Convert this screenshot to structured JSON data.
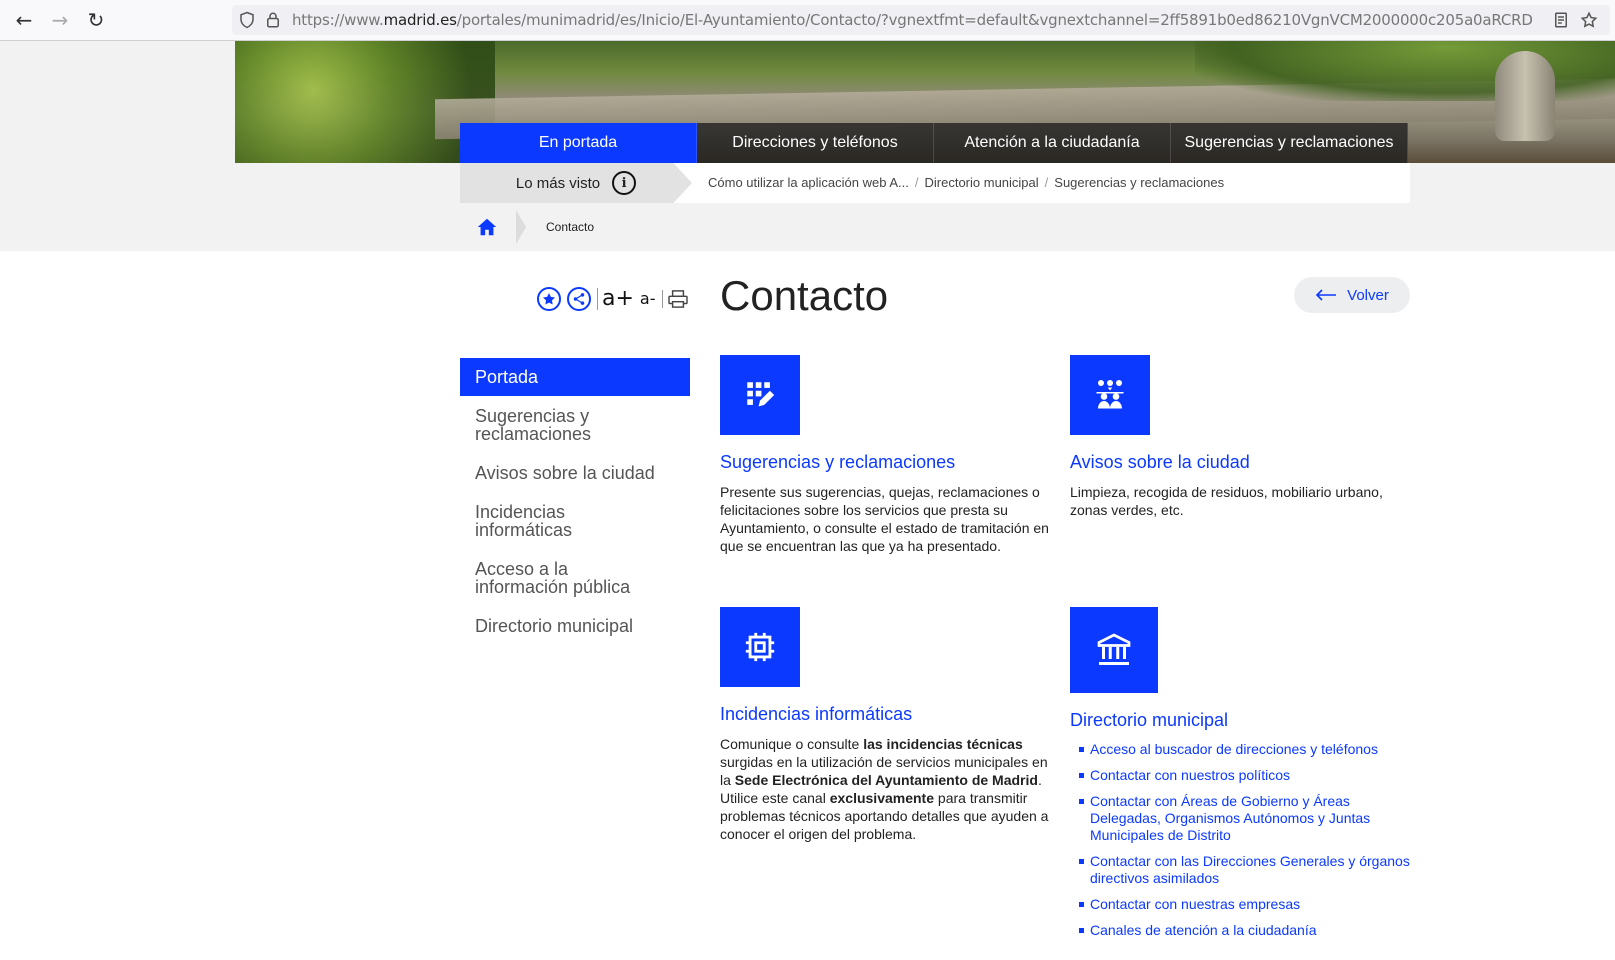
{
  "browser": {
    "url_prefix": "https://www.",
    "url_domain": "madrid.es",
    "url_path": "/portales/munimadrid/es/Inicio/El-Ayuntamiento/Contacto/?vgnextfmt=default&vgnextchannel=2ff5891b0ed86210VgnVCM2000000c205a0aRCRD"
  },
  "topmenu": {
    "items": [
      "En portada",
      "Direcciones y teléfonos",
      "Atención a la ciudadanía",
      "Sugerencias y reclamaciones"
    ]
  },
  "second_row": {
    "mas_visto": "Lo más visto",
    "links": [
      "Cómo utilizar la aplicación web A...",
      "Directorio municipal",
      "Sugerencias y reclamaciones"
    ]
  },
  "breadcrumb": {
    "current": "Contacto"
  },
  "tools": {
    "increase": "a+",
    "decrease": "a-"
  },
  "page": {
    "title": "Contacto",
    "back": "Volver"
  },
  "sidenav": {
    "items": [
      "Portada",
      "Sugerencias y reclamaciones",
      "Avisos sobre la ciudad",
      "Incidencias informáticas",
      "Acceso a la información pública",
      "Directorio municipal"
    ]
  },
  "cards": {
    "sugerencias": {
      "title": "Sugerencias y reclamaciones",
      "desc": "Presente sus sugerencias, quejas, reclamaciones o felicitaciones sobre los servicios que presta su Ayuntamiento, o consulte el estado de tramitación en que se encuentran las que ya ha presentado."
    },
    "avisos": {
      "title": "Avisos sobre la ciudad",
      "desc": "Limpieza, recogida de residuos, mobiliario urbano, zonas verdes, etc."
    },
    "incidencias": {
      "title": "Incidencias informáticas",
      "desc_parts": [
        "Comunique o consulte ",
        "las incidencias técnicas",
        " surgidas en la utilización de servicios municipales en la ",
        "Sede Electrónica del Ayuntamiento de Madrid",
        ". Utilice este canal ",
        "exclusivamente",
        " para transmitir problemas técnicos aportando detalles que ayuden a conocer el origen del problema."
      ]
    },
    "directorio": {
      "title": "Directorio municipal",
      "links": [
        "Acceso al buscador de direcciones y teléfonos",
        "Contactar con nuestros políticos",
        "Contactar con Áreas de Gobierno y Áreas Delegadas, Organismos Autónomos y Juntas Municipales de Distrito",
        "Contactar con las Direcciones Generales y órganos directivos asimilados",
        "Contactar con nuestras empresas",
        "Canales de atención a la ciudadanía"
      ]
    }
  },
  "colors": {
    "accent": "#0b39ff",
    "menu_dark": "#1e1e1e",
    "header_gray": "#f2f2f2"
  },
  "icons": [
    "back-arrow-icon",
    "forward-arrow-icon",
    "reload-icon",
    "shield-icon",
    "lock-icon",
    "reader-mode-icon",
    "bookmark-star-icon",
    "info-icon",
    "home-icon",
    "favorite-star-icon",
    "share-icon",
    "print-icon",
    "back-arrow-icon",
    "edit-grid-icon",
    "people-group-icon",
    "chip-icon",
    "institution-icon"
  ]
}
